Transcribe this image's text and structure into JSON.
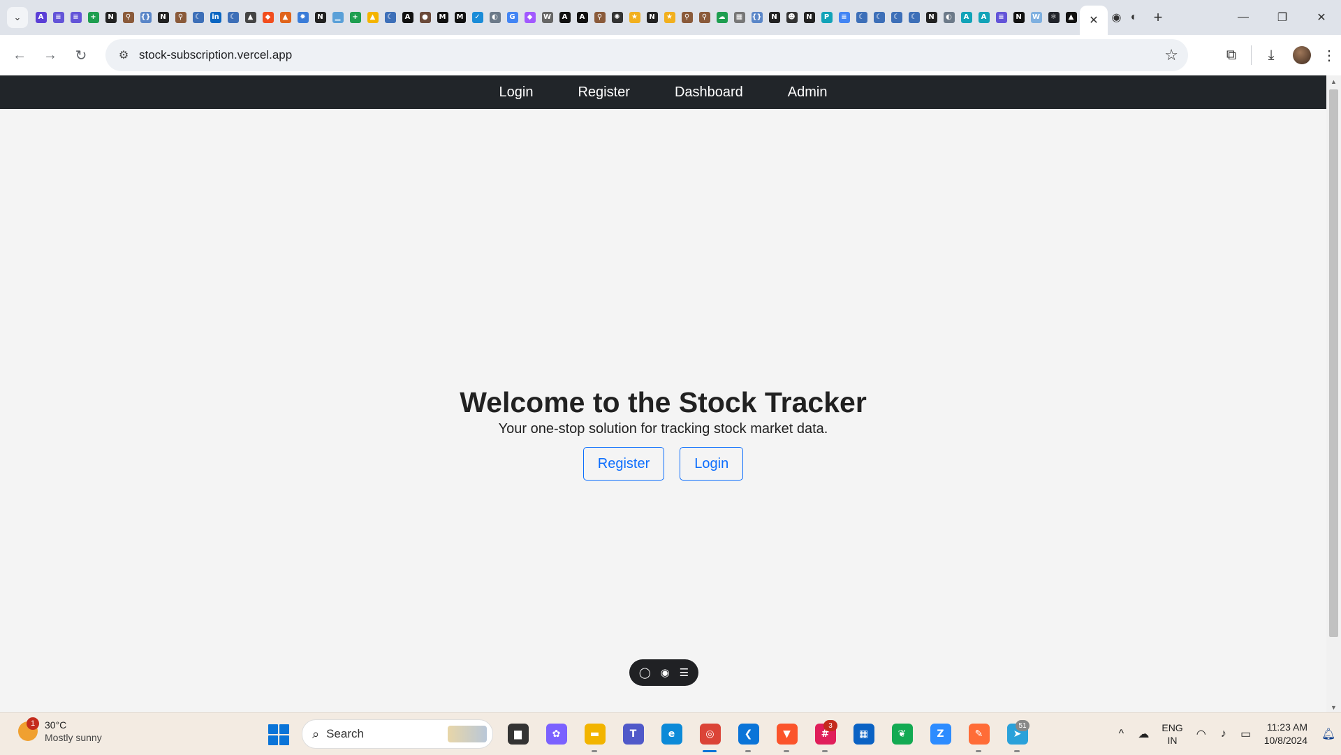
{
  "browser": {
    "pinned_tabs": [
      {
        "icon": "A-app",
        "color": "#5b3fd6",
        "glyph": "A"
      },
      {
        "icon": "list-app",
        "color": "#6354d8",
        "glyph": "≡"
      },
      {
        "icon": "list-app",
        "color": "#6354d8",
        "glyph": "≡"
      },
      {
        "icon": "plus-app",
        "color": "#1e9e50",
        "glyph": "+"
      },
      {
        "icon": "notion-icon",
        "color": "#222222",
        "glyph": "N"
      },
      {
        "icon": "pin-icon",
        "color": "#8a5a3a",
        "glyph": "⚲"
      },
      {
        "icon": "code-icon",
        "color": "#5a86c8",
        "glyph": "{}"
      },
      {
        "icon": "notion-icon",
        "color": "#222222",
        "glyph": "N"
      },
      {
        "icon": "pin-icon",
        "color": "#8a5a3a",
        "glyph": "⚲"
      },
      {
        "icon": "leaf-icon",
        "color": "#3d6fb8",
        "glyph": "☾"
      },
      {
        "icon": "linkedin-icon",
        "color": "#0a66c2",
        "glyph": "in"
      },
      {
        "icon": "leaf-icon",
        "color": "#3d6fb8",
        "glyph": "☾"
      },
      {
        "icon": "graduation-icon",
        "color": "#444444",
        "glyph": "▲"
      },
      {
        "icon": "figma-icon",
        "color": "#f24e1e",
        "glyph": "◆"
      },
      {
        "icon": "cone-icon",
        "color": "#e0641b",
        "glyph": "▲"
      },
      {
        "icon": "sunburst-icon",
        "color": "#3a7cd8",
        "glyph": "✹"
      },
      {
        "icon": "notion-icon",
        "color": "#222222",
        "glyph": "N"
      },
      {
        "icon": "chart-icon",
        "color": "#5aa0d8",
        "glyph": "▁"
      },
      {
        "icon": "plus-app",
        "color": "#1e9e50",
        "glyph": "+"
      },
      {
        "icon": "drive-icon",
        "color": "#f4b400",
        "glyph": "▲"
      },
      {
        "icon": "leaf-icon",
        "color": "#3d6fb8",
        "glyph": "☾"
      },
      {
        "icon": "openai-icon",
        "color": "#111111",
        "glyph": "A"
      },
      {
        "icon": "person-icon",
        "color": "#6b4a3a",
        "glyph": "●"
      },
      {
        "icon": "medium-icon",
        "color": "#111111",
        "glyph": "M"
      },
      {
        "icon": "medium-icon",
        "color": "#111111",
        "glyph": "M"
      },
      {
        "icon": "check-icon",
        "color": "#1a8cd8",
        "glyph": "✓"
      },
      {
        "icon": "globe-icon",
        "color": "#6c7a89",
        "glyph": "◐"
      },
      {
        "icon": "google-icon",
        "color": "#4285f4",
        "glyph": "G"
      },
      {
        "icon": "figma-icon",
        "color": "#a259ff",
        "glyph": "◆"
      },
      {
        "icon": "wiki-icon",
        "color": "#666666",
        "glyph": "W"
      },
      {
        "icon": "openai-icon",
        "color": "#111111",
        "glyph": "A"
      },
      {
        "icon": "openai-icon",
        "color": "#111111",
        "glyph": "A"
      },
      {
        "icon": "pin-icon",
        "color": "#8a5a3a",
        "glyph": "⚲"
      },
      {
        "icon": "chatgpt-icon",
        "color": "#333333",
        "glyph": "✺"
      },
      {
        "icon": "star-icon",
        "color": "#f2b01e",
        "glyph": "★"
      },
      {
        "icon": "notion-icon",
        "color": "#222222",
        "glyph": "N"
      },
      {
        "icon": "star-icon",
        "color": "#f2b01e",
        "glyph": "★"
      },
      {
        "icon": "pin-icon",
        "color": "#8a5a3a",
        "glyph": "⚲"
      },
      {
        "icon": "pin-icon",
        "color": "#8a5a3a",
        "glyph": "⚲"
      },
      {
        "icon": "cloud-icon",
        "color": "#1e9e50",
        "glyph": "☁"
      },
      {
        "icon": "grid-icon",
        "color": "#777777",
        "glyph": "▦"
      },
      {
        "icon": "code-icon",
        "color": "#5a86c8",
        "glyph": "{}"
      },
      {
        "icon": "notion-icon",
        "color": "#222222",
        "glyph": "N"
      },
      {
        "icon": "face-icon",
        "color": "#333333",
        "glyph": "☻"
      },
      {
        "icon": "notion-icon",
        "color": "#222222",
        "glyph": "N"
      },
      {
        "icon": "p-app",
        "color": "#12a3b8",
        "glyph": "P"
      },
      {
        "icon": "docs-icon",
        "color": "#4285f4",
        "glyph": "≡"
      },
      {
        "icon": "leaf-icon",
        "color": "#3d6fb8",
        "glyph": "☾"
      },
      {
        "icon": "leaf-icon",
        "color": "#3d6fb8",
        "glyph": "☾"
      },
      {
        "icon": "leaf-icon",
        "color": "#3d6fb8",
        "glyph": "☾"
      },
      {
        "icon": "leaf-icon",
        "color": "#3d6fb8",
        "glyph": "☾"
      },
      {
        "icon": "notion-icon",
        "color": "#222222",
        "glyph": "N"
      },
      {
        "icon": "globe-icon",
        "color": "#6c7a89",
        "glyph": "◐"
      },
      {
        "icon": "a-app",
        "color": "#12a3b8",
        "glyph": "A"
      },
      {
        "icon": "a-app",
        "color": "#12a3b8",
        "glyph": "A"
      },
      {
        "icon": "list-app",
        "color": "#6354d8",
        "glyph": "≡"
      },
      {
        "icon": "n-dark-icon",
        "color": "#111111",
        "glyph": "N"
      },
      {
        "icon": "w-app",
        "color": "#7fb0e0",
        "glyph": "W"
      },
      {
        "icon": "react-icon",
        "color": "#20232a",
        "glyph": "⚛"
      },
      {
        "icon": "vercel-icon",
        "color": "#111111",
        "glyph": "▲"
      }
    ],
    "after_tabs": [
      {
        "icon": "github-icon",
        "glyph": "◉"
      },
      {
        "icon": "globe-icon",
        "glyph": "◐"
      }
    ],
    "url": "stock-subscription.vercel.app"
  },
  "site": {
    "nav": [
      "Login",
      "Register",
      "Dashboard",
      "Admin"
    ],
    "hero": {
      "title": "Welcome to the Stock Tracker",
      "subtitle": "Your one-stop solution for tracking stock market data.",
      "register_label": "Register",
      "login_label": "Login"
    },
    "accent_color": "#0d6efd",
    "navbar_color": "#212529"
  },
  "taskbar": {
    "weather": {
      "badge": "1",
      "temp": "30°C",
      "desc": "Mostly sunny"
    },
    "search_label": "Search",
    "apps": [
      {
        "icon": "files-icon",
        "color": "#333333",
        "glyph": "▆"
      },
      {
        "icon": "copilot-icon",
        "color": "#7b61ff",
        "glyph": "✿"
      },
      {
        "icon": "file-explorer-icon",
        "color": "#f2b400",
        "glyph": "▬"
      },
      {
        "icon": "teams-icon",
        "color": "#5059c9",
        "glyph": "T"
      },
      {
        "icon": "edge-icon",
        "color": "#0c8ad8",
        "glyph": "e"
      },
      {
        "icon": "chrome-icon",
        "color": "#db4437",
        "glyph": "◎"
      },
      {
        "icon": "vscode-icon",
        "color": "#0a74d8",
        "glyph": "❮"
      },
      {
        "icon": "brave-icon",
        "color": "#fb542b",
        "glyph": "▼"
      },
      {
        "icon": "slack-icon",
        "color": "#e01e5a",
        "glyph": "#"
      },
      {
        "icon": "store-icon",
        "color": "#0a62c4",
        "glyph": "▦"
      },
      {
        "icon": "mongodb-icon",
        "color": "#13aa52",
        "glyph": "❦"
      },
      {
        "icon": "zoom-icon",
        "color": "#2d8cff",
        "glyph": "Z"
      },
      {
        "icon": "postman-icon",
        "color": "#ff6c37",
        "glyph": "✎"
      },
      {
        "icon": "telegram-icon",
        "color": "#2aa1da",
        "glyph": "➤"
      }
    ],
    "slack_badge": "3",
    "telegram_badge": "51",
    "language": [
      "ENG",
      "IN"
    ],
    "time": "11:23 AM",
    "date": "10/8/2024"
  }
}
